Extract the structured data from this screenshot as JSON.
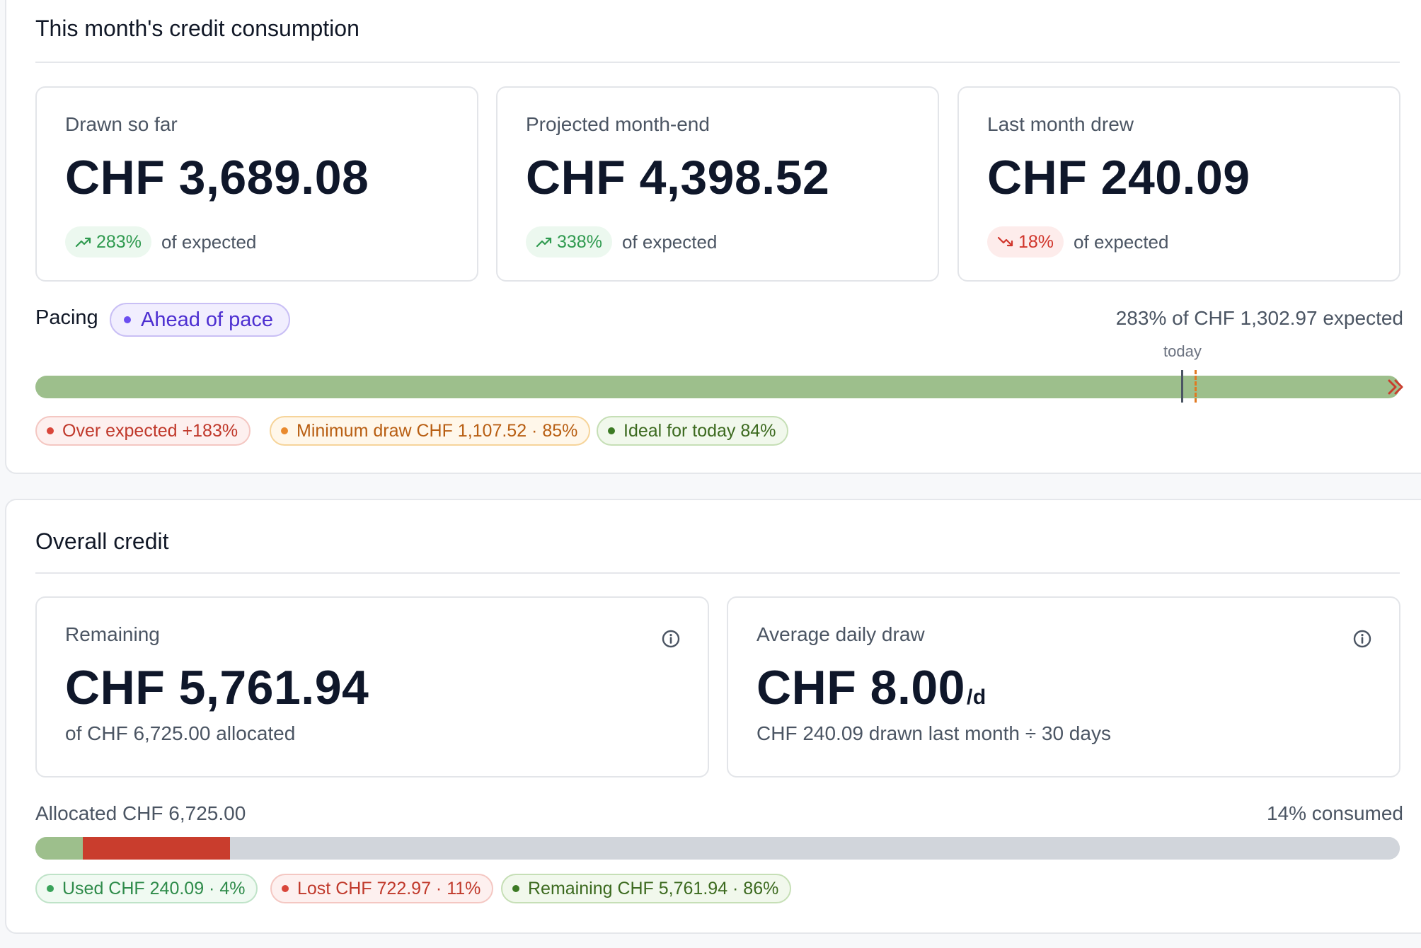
{
  "month": {
    "title": "This month's credit consumption",
    "cards": [
      {
        "label": "Drawn so far",
        "value": "CHF 3,689.08",
        "delta": "283%",
        "direction": "up",
        "note": "of expected"
      },
      {
        "label": "Projected month-end",
        "value": "CHF 4,398.52",
        "delta": "338%",
        "direction": "up",
        "note": "of expected"
      },
      {
        "label": "Last month drew",
        "value": "CHF 240.09",
        "delta": "18%",
        "direction": "down",
        "note": "of expected"
      }
    ],
    "pacing": {
      "label": "Pacing",
      "status": "Ahead of pace",
      "summary": "283% of CHF 1,302.97 expected",
      "today_label": "today",
      "progress_fraction": 1.0,
      "overflow": true,
      "today_fraction": 0.84,
      "minimum_fraction": 0.85
    },
    "legend": [
      {
        "label": "Over expected +183%",
        "tone": "red"
      },
      {
        "label": "Minimum draw CHF 1,107.52 · 85%",
        "tone": "orange"
      },
      {
        "label": "Ideal for today 84%",
        "tone": "green"
      }
    ]
  },
  "overall": {
    "title": "Overall credit",
    "remaining": {
      "label": "Remaining",
      "value": "CHF 5,761.94",
      "sub": "of CHF 6,725.00 allocated",
      "icon": "info-icon"
    },
    "average": {
      "label": "Average daily draw",
      "value": "CHF 8.00",
      "unit": "/d",
      "sub": "CHF 240.09 drawn last month ÷ 30 days",
      "icon": "info-icon"
    },
    "allocated_label": "Allocated CHF 6,725.00",
    "consumed_label": "14% consumed",
    "segments": [
      {
        "name": "used",
        "fraction": 0.035,
        "color": "#9dbf8c"
      },
      {
        "name": "lost",
        "fraction": 0.1075,
        "color": "#c93d2d"
      },
      {
        "name": "remaining",
        "fraction": 0.8575,
        "color": "#d1d5db"
      }
    ],
    "legend": [
      {
        "label": "Used CHF 240.09 · 4%",
        "tone": "green"
      },
      {
        "label": "Lost CHF 722.97 · 11%",
        "tone": "red"
      },
      {
        "label": "Remaining CHF 5,761.94 · 86%",
        "tone": "darkgreen"
      }
    ]
  },
  "colors": {
    "pace_bar": "#9dbf8c",
    "today_marker": "#4b5563",
    "minimum_marker": "#e07a22",
    "overflow_chevron": "#c93d2d",
    "pace_badge_dot": "#6b4ef0"
  }
}
